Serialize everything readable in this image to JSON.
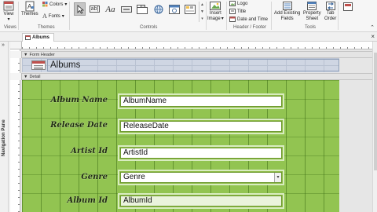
{
  "ribbon": {
    "views": {
      "view_label": "View",
      "group_label": "Views"
    },
    "themes": {
      "themes_label": "Themes",
      "colors_label": "Colors",
      "fonts_label": "Fonts",
      "group_label": "Themes"
    },
    "controls": {
      "text_glyph": "Aa",
      "textbox_glyph": "ab|",
      "group_label": "Controls"
    },
    "insert": {
      "insert_image_label": "Insert",
      "insert_image_label2": "Image"
    },
    "header_footer": {
      "logo_label": "Logo",
      "title_label": "Title",
      "date_time_label": "Date and Time",
      "group_label": "Header / Footer"
    },
    "tools": {
      "add_fields_label": "Add Existing",
      "add_fields_label2": "Fields",
      "property_sheet_label": "Property",
      "property_sheet_label2": "Sheet",
      "tab_order_label": "Tab",
      "tab_order_label2": "Order",
      "group_label": "Tools"
    }
  },
  "document_tab": {
    "label": "Albums"
  },
  "nav_pane": {
    "label": "Navigation Pane"
  },
  "sections": {
    "form_header": "Form Header",
    "detail": "Detail"
  },
  "form": {
    "title": "Albums",
    "fields": [
      {
        "label": "Album Name",
        "control": "AlbumName",
        "type": "textbox"
      },
      {
        "label": "Release Date",
        "control": "ReleaseDate",
        "type": "textbox"
      },
      {
        "label": "Artist Id",
        "control": "ArtistId",
        "type": "textbox"
      },
      {
        "label": "Genre",
        "control": "Genre",
        "type": "combobox"
      },
      {
        "label": "Album Id",
        "control": "AlbumId",
        "type": "textbox"
      }
    ]
  },
  "colors": {
    "detail_band": "#92c451",
    "header_band": "#cfd6e3",
    "field_border": "#d8ecc0",
    "label_text": "#1e2a10"
  }
}
